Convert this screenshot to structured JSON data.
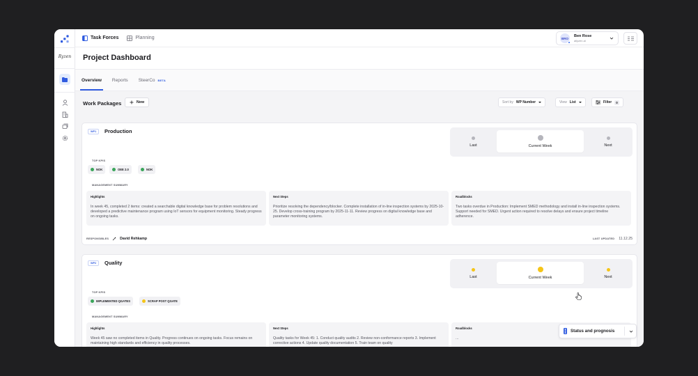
{
  "rail": {
    "brand": "Ryzen"
  },
  "topnav": {
    "items": [
      {
        "label": "Task Forces"
      },
      {
        "label": "Planning"
      }
    ]
  },
  "user": {
    "initials": "BRO",
    "name": "Ben Rose",
    "org": "allyzen.ai"
  },
  "page": {
    "title": "Project Dashboard"
  },
  "tabs": [
    {
      "label": "Overview"
    },
    {
      "label": "Reports"
    },
    {
      "label": "SteerCo",
      "badge": "BETA"
    }
  ],
  "toolbar": {
    "title": "Work Packages",
    "new_label": "New",
    "sort_label": "Sort by",
    "sort_value": "WP Number",
    "view_label": "View",
    "view_value": "List",
    "filter_label": "Filter",
    "filter_count": "0"
  },
  "labels": {
    "last": "Last",
    "current": "Current Week",
    "next": "Next",
    "top_kpis": "TOP KPIS",
    "management_summary": "MANAGEMENT SUMMARY",
    "highlights": "Highlights",
    "next_steps": "Next Steps",
    "roadblocks": "Roadblocks",
    "responsibles": "RESPONSIBLES",
    "last_updated": "LAST UPDATED"
  },
  "colors": {
    "accent": "#2f5be0",
    "green": "#3aa55a",
    "yellow": "#f5c518",
    "grey": "#b5b5bc"
  },
  "work_packages": [
    {
      "id": "WP1",
      "name": "Production",
      "status_color": "#b5b5bc",
      "kpis": [
        {
          "label": "NOK",
          "color": "#3aa55a"
        },
        {
          "label": "OEE 2.0",
          "color": "#3aa55a"
        },
        {
          "label": "NOK",
          "color": "#3aa55a"
        }
      ],
      "highlights": "In week 45, completed 2 items: created a searchable digital knowledge base for problem resolutions and developed a predictive maintenance program using IoT sensors for equipment monitoring. Steady progress on ongoing tasks.",
      "next_steps": "Prioritize resolving the dependency/blocker. Complete installation of in-line inspection systems by 2025-10-25. Develop cross-training program by 2025-11-11. Review progress on digital knowledge base and parameter monitoring systems.",
      "roadblocks": "Two tasks overdue in Production: Implement SMED methodology and install in-line inspection systems. Support needed for SMED. Urgent action required to resolve delays and ensure project timeline adherence.",
      "responsible": "David Rehkamp",
      "updated": "11.12.25"
    },
    {
      "id": "WP2",
      "name": "Quality",
      "status_color": "#f5c518",
      "kpis": [
        {
          "label": "IMPLEMENTED QGATES",
          "color": "#3aa55a"
        },
        {
          "label": "SCRAP POST QGATE",
          "color": "#f5c518"
        }
      ],
      "highlights": "Week 45 saw no completed items in Quality. Progress continues on ongoing tasks. Focus remains on maintaining high standards and efficiency in quality processes.",
      "next_steps": "Quality tasks for Week 45: 1. Conduct quality audits 2. Review non-conformance reports 3. Implement corrective actions 4. Update quality documentation 5. Train team on quality",
      "roadblocks": "..."
    }
  ],
  "status_panel": {
    "label": "Status and prognosis"
  }
}
